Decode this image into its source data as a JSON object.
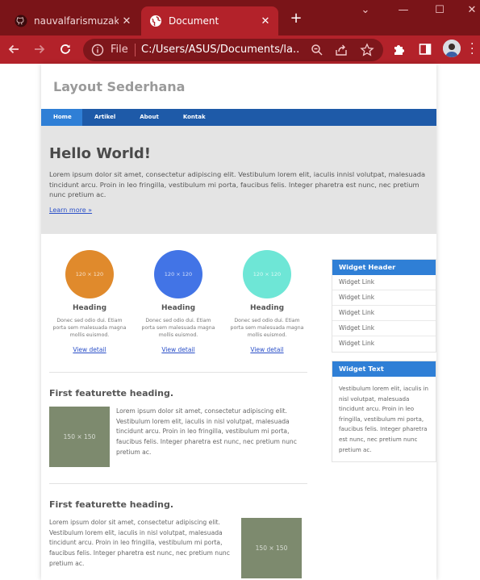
{
  "browser": {
    "tabs": [
      {
        "title": "nauvalfarismuzaki/la",
        "active": false,
        "icon": "github-icon"
      },
      {
        "title": "Document",
        "active": true,
        "icon": "globe-icon"
      }
    ],
    "new_tab": "+",
    "window_controls": {
      "dropdown": "⌄",
      "minimize": "—",
      "maximize": "☐",
      "close": "✕"
    },
    "close_glyph": "✕",
    "address": {
      "scheme": "File",
      "url": "C:/Users/ASUS/Documents/la..."
    },
    "colors": {
      "tabbar": "#7a1418",
      "toolbar": "#b3222a",
      "omnibox": "#7e161b"
    }
  },
  "page": {
    "site_title": "Layout Sederhana",
    "nav": [
      {
        "label": "Home",
        "active": true
      },
      {
        "label": "Artikel",
        "active": false
      },
      {
        "label": "About",
        "active": false
      },
      {
        "label": "Kontak",
        "active": false
      }
    ],
    "jumbotron": {
      "title": "Hello World!",
      "text": "Lorem ipsum dolor sit amet, consectetur adipiscing elit. Vestibulum lorem elit, iaculis innisl volutpat, malesuada tincidunt arcu. Proin in leo fringilla, vestibulum mi porta, faucibus felis. Integer pharetra est nunc, nec pretium nunc pretium ac.",
      "link": "Learn more »"
    },
    "features": [
      {
        "circle_label": "120 × 120",
        "color": "#e08a2c",
        "heading": "Heading",
        "text": "Donec sed odio dui. Etiam porta sem malesuada magna mollis euismod.",
        "link": "View detail"
      },
      {
        "circle_label": "120 × 120",
        "color": "#4274e6",
        "heading": "Heading",
        "text": "Donec sed odio dui. Etiam porta sem malesuada magna mollis euismod.",
        "link": "View detail"
      },
      {
        "circle_label": "120 × 120",
        "color": "#6ee6d6",
        "heading": "Heading",
        "text": "Donec sed odio dui. Etiam porta sem malesuada magna mollis euismod.",
        "link": "View detail"
      }
    ],
    "featurettes": [
      {
        "heading": "First featurette heading.",
        "image_label": "150 × 150",
        "text": "Lorem ipsum dolor sit amet, consectetur adipiscing elit. Vestibulum lorem elit, iaculis in nisl volutpat, malesuada tincidunt arcu. Proin in leo fringilla, vestibulum mi porta, faucibus felis. Integer pharetra est nunc, nec pretium nunc pretium ac."
      },
      {
        "heading": "First featurette heading.",
        "image_label": "150 × 150",
        "text": "Lorem ipsum dolor sit amet, consectetur adipiscing elit. Vestibulum lorem elit, iaculis in nisl volutpat, malesuada tincidunt arcu. Proin in leo fringilla, vestibulum mi porta, faucibus felis. Integer pharetra est nunc, nec pretium nunc pretium ac."
      }
    ],
    "sidebar": {
      "widget1": {
        "header": "Widget Header",
        "links": [
          "Widget Link",
          "Widget Link",
          "Widget Link",
          "Widget Link",
          "Widget Link"
        ]
      },
      "widget2": {
        "header": "Widget Text",
        "text": "Vestibulum lorem elit, iaculis in nisl volutpat, malesuada tincidunt arcu. Proin in leo fringilla, vestibulum mi porta, faucibus felis. Integer pharetra est nunc, nec pretium nunc pretium ac."
      }
    },
    "colors": {
      "nav": "#1e5aa8",
      "nav_active": "#2f7fd6",
      "widget_header": "#2f7fd6",
      "jumbotron": "#e4e4e4",
      "placeholder": "#7d8a6e"
    }
  }
}
